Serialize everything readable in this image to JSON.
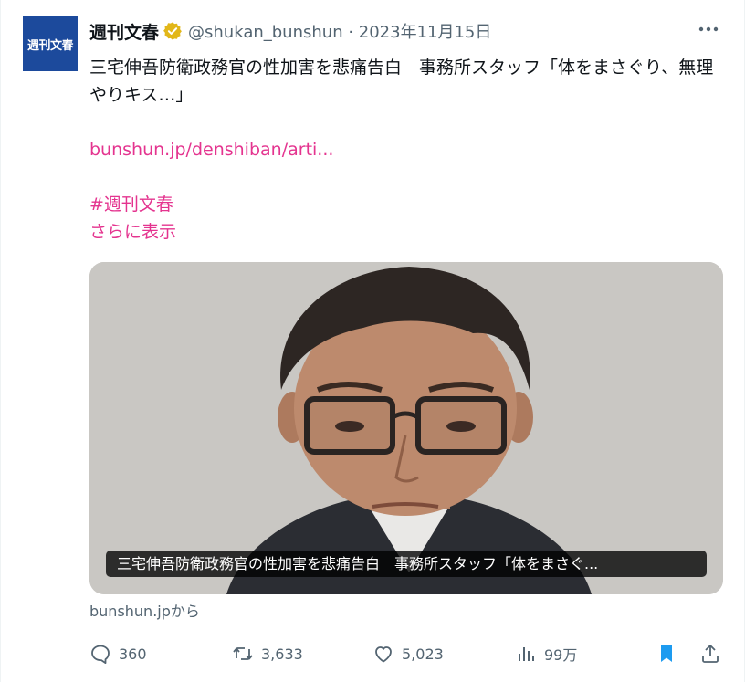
{
  "tweet": {
    "avatar_text": "週刊文春",
    "display_name": "週刊文春",
    "handle": "@shukan_bunshun · 2023年11月15日",
    "body": "三宅伸吾防衛政務官の性加害を悲痛告白　事務所スタッフ「体をまさぐり、無理やりキス…」",
    "link": "bunshun.jp/denshiban/arti...",
    "hashtag": "#週刊文春",
    "show_more": "さらに表示",
    "card": {
      "caption": "三宅伸吾防衛政務官の性加害を悲痛告白　事務所スタッフ「体をまさぐ..."
    },
    "source": "bunshun.jpから",
    "actions": {
      "replies": "360",
      "retweets": "3,633",
      "likes": "5,023",
      "views": "99万"
    }
  },
  "icons": {
    "verified": "verified-badge-icon",
    "more": "more-dots-icon",
    "reply": "reply-bubble-icon",
    "retweet": "retweet-icon",
    "like": "heart-icon",
    "views": "bar-chart-icon",
    "bookmark": "bookmark-icon",
    "share": "share-upload-icon"
  },
  "colors": {
    "link": "#e4348f",
    "secondary_text": "#536471",
    "bookmark_active": "#1d9bf0",
    "verified_gold": "#e2b719",
    "avatar_bg": "#1c4a9c"
  }
}
